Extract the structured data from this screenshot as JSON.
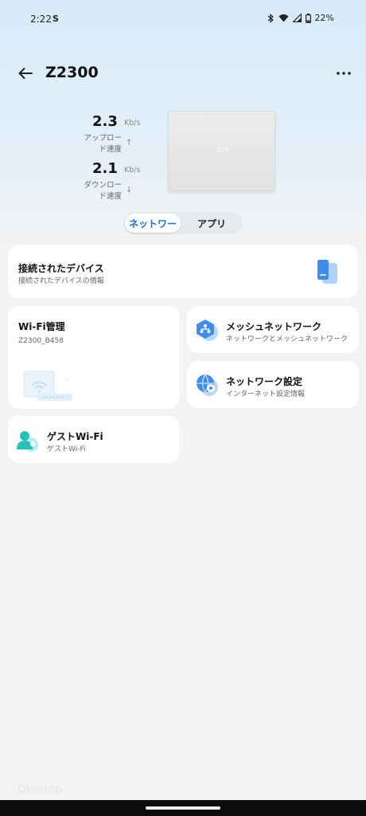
{
  "status": {
    "time": "2:22",
    "notif_icon": "S",
    "battery": "22%"
  },
  "header": {
    "title": "Z2300"
  },
  "speeds": {
    "upload": {
      "value": "2.3",
      "unit": "Kb/s",
      "label": "アップロード速度",
      "arrow": "↑"
    },
    "download": {
      "value": "2.1",
      "unit": "Kb/s",
      "label": "ダウンロード速度",
      "arrow": "↓"
    }
  },
  "router": {
    "logo_text": "ZTE"
  },
  "tabs": [
    {
      "label": "ネットワー",
      "active": true
    },
    {
      "label": "アプリ",
      "active": false
    }
  ],
  "cards": {
    "connected_devices": {
      "title": "接続されたデバイス",
      "subtitle": "接続されたデバイスの情報"
    },
    "wifi": {
      "title": "Wi-Fi管理",
      "subtitle": "Z2300_B458"
    },
    "mesh": {
      "title": "メッシュネットワーク",
      "subtitle": "ネットワークとメッシュネットワーク"
    },
    "network_settings": {
      "title": "ネットワーク設定",
      "subtitle": "インターネット設定情報"
    },
    "guest": {
      "title": "ゲストWi-Fi",
      "subtitle": "ゲストWi-Fi"
    }
  },
  "watermark": "Oknetop",
  "colors": {
    "accent": "#1672d4",
    "icon_blue": "#3f8de6"
  }
}
